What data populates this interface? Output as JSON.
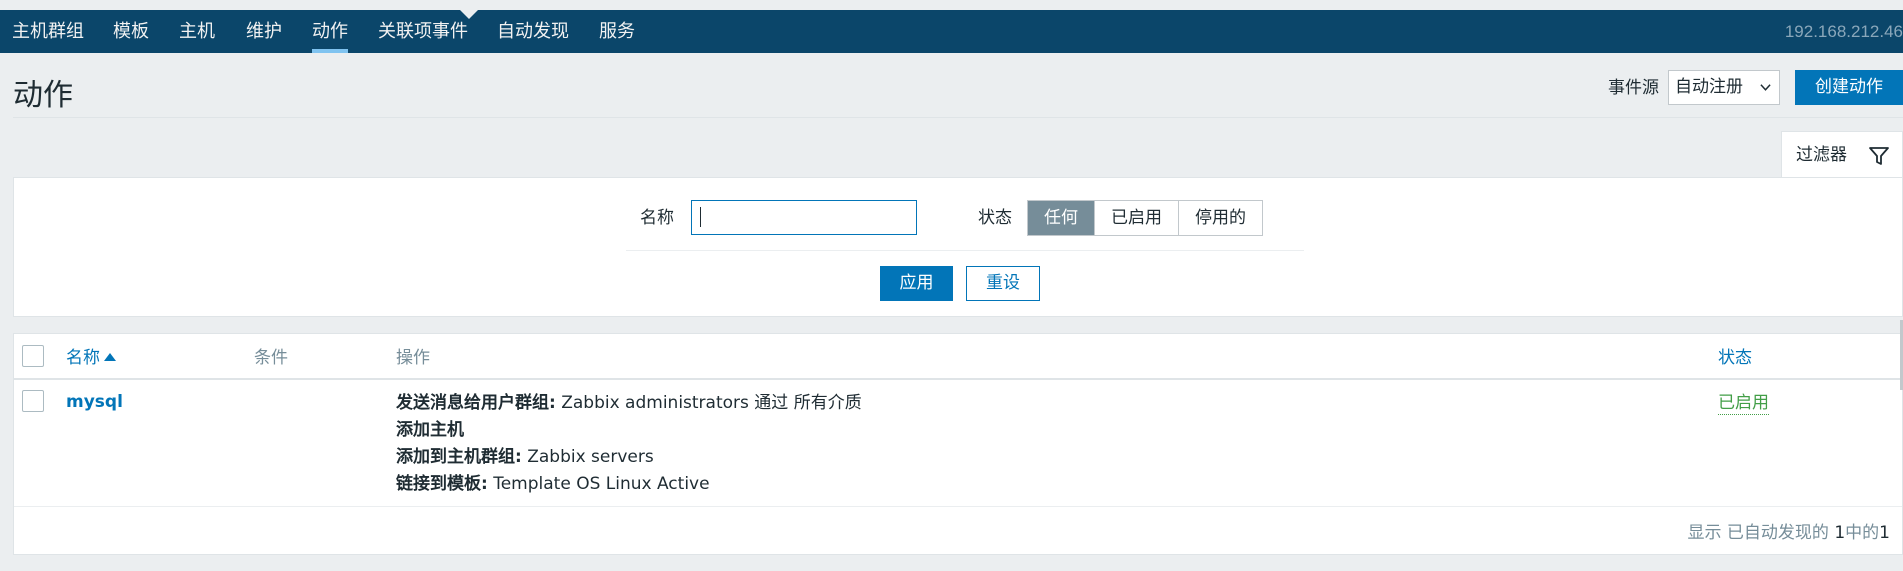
{
  "nav": {
    "items": [
      {
        "label": "主机群组"
      },
      {
        "label": "模板"
      },
      {
        "label": "主机"
      },
      {
        "label": "维护"
      },
      {
        "label": "动作"
      },
      {
        "label": "关联项事件"
      },
      {
        "label": "自动发现"
      },
      {
        "label": "服务"
      }
    ],
    "active_index": 4,
    "server_ip": "192.168.212.46",
    "colors": {
      "bar": "#0b466a",
      "active_underline": "#7fc3f0"
    }
  },
  "header": {
    "title": "动作",
    "event_source_label": "事件源",
    "event_source_value": "自动注册",
    "create_button": "创建动作"
  },
  "filter": {
    "tab_label": "过滤器",
    "tab_icon": "filter-icon",
    "name_label": "名称",
    "name_value": "",
    "status_label": "状态",
    "status_options": [
      "任何",
      "已启用",
      "停用的"
    ],
    "status_selected": "任何",
    "apply_button": "应用",
    "reset_button": "重设"
  },
  "table": {
    "columns": {
      "name": "名称",
      "conditions": "条件",
      "operations": "操作",
      "status": "状态"
    },
    "sort": {
      "column": "name",
      "direction": "asc"
    },
    "rows": [
      {
        "name": "mysql",
        "conditions": "",
        "operations": [
          {
            "bold": "发送消息给用户群组:",
            "text": " Zabbix administrators 通过 所有介质"
          },
          {
            "bold": "添加主机",
            "text": ""
          },
          {
            "bold": "添加到主机群组:",
            "text": " Zabbix servers"
          },
          {
            "bold": "链接到模板:",
            "text": " Template OS Linux Active"
          }
        ],
        "status": "已启用"
      }
    ],
    "footer": {
      "prefix": "显示 已自动发现的 ",
      "count": "1",
      "middle": "中的",
      "total": "1"
    }
  },
  "colors": {
    "primary": "#0275b8",
    "enabled": "#429e47",
    "muted": "#768d99",
    "background": "#ebeef0"
  }
}
